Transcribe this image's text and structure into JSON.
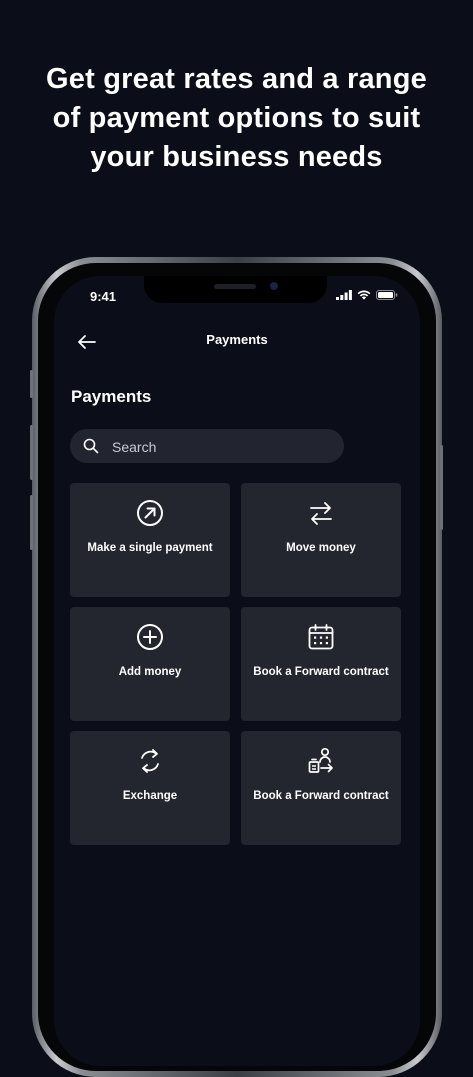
{
  "headline": {
    "line1": "Get great rates and a range",
    "line2": "of payment options to suit",
    "line3": "your business needs"
  },
  "status_bar": {
    "time": "9:41"
  },
  "nav": {
    "title": "Payments",
    "back_icon": "arrow-left-icon"
  },
  "page": {
    "title": "Payments"
  },
  "search": {
    "placeholder": "Search",
    "value": ""
  },
  "tiles": [
    {
      "label": "Make a single payment",
      "icon": "arrow-up-right-circle-icon"
    },
    {
      "label": "Move money",
      "icon": "transfer-arrows-icon"
    },
    {
      "label": "Add money",
      "icon": "plus-circle-icon"
    },
    {
      "label": "Book a Forward contract",
      "icon": "calendar-icon"
    },
    {
      "label": "Exchange",
      "icon": "refresh-icon"
    },
    {
      "label": "Book a Forward contract",
      "icon": "person-transfer-icon"
    }
  ],
  "colors": {
    "background": "#0b0d18",
    "tile": "#23252f",
    "search": "#22242f",
    "text": "#ffffff"
  }
}
